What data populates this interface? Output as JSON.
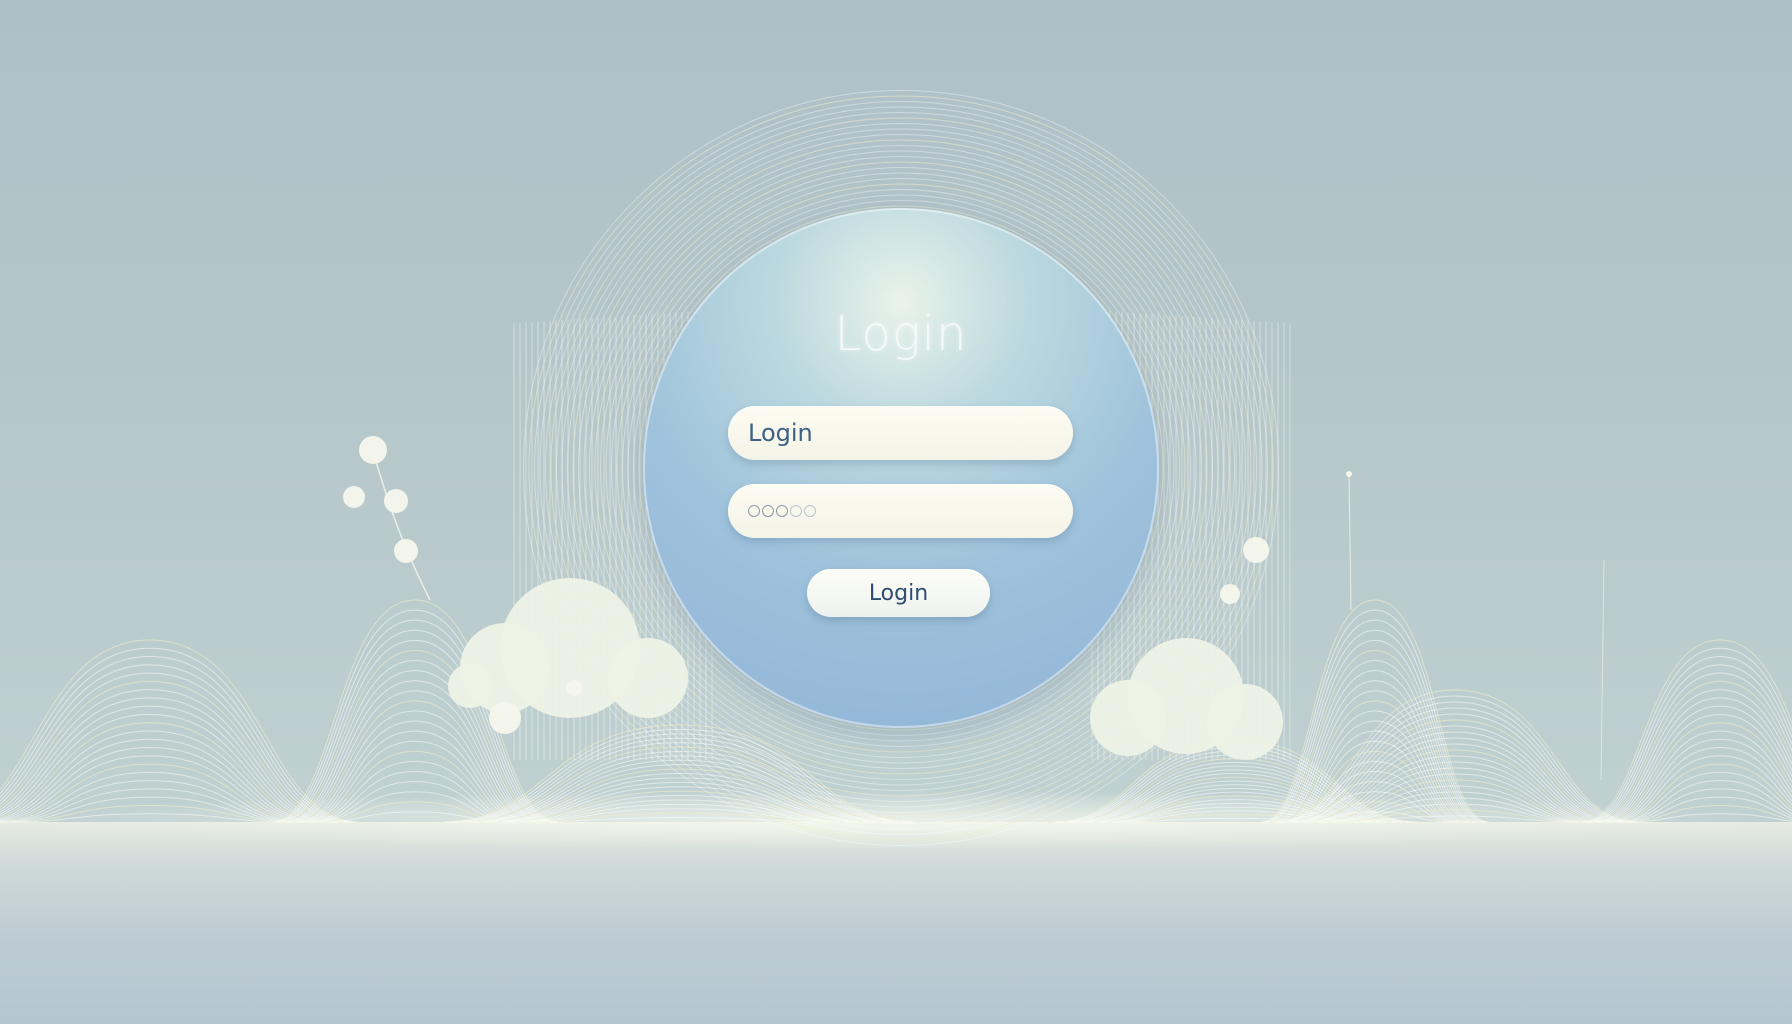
{
  "login": {
    "title": "Login",
    "username_value": "Login",
    "password_mask_count": 5,
    "button_label": "Login"
  },
  "colors": {
    "background": "#b7c8cb",
    "circle": "#9fc3dc",
    "field": "#fdfcf2",
    "button_text": "#2f4d72",
    "title_text": "#f4f8f7"
  },
  "decorations": {
    "icons": [
      "cloud-left",
      "cloud-right",
      "pearl-sprig",
      "wavy-line-hills"
    ]
  }
}
